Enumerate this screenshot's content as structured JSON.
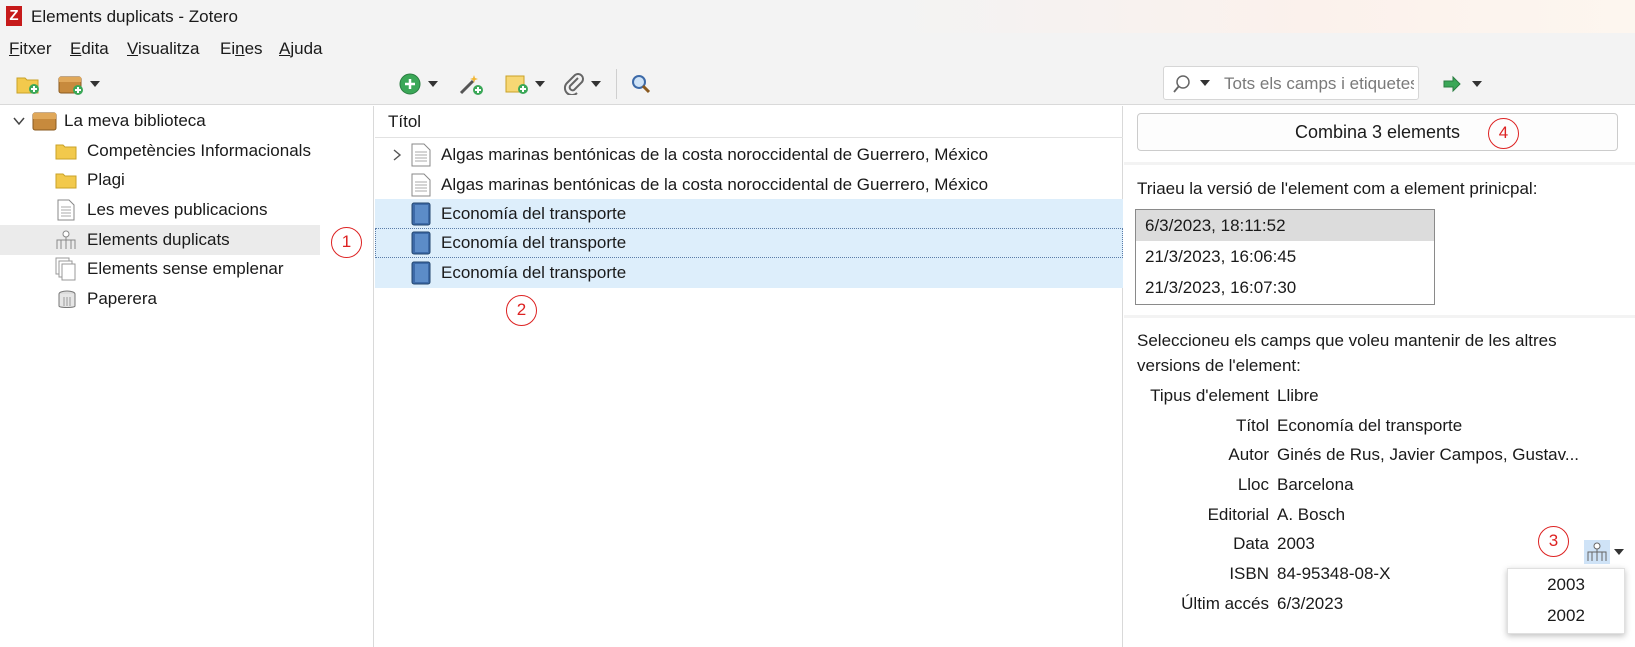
{
  "window": {
    "title": "Elements duplicats - Zotero",
    "app_icon_letter": "Z"
  },
  "menu": [
    {
      "label": "Fitxer",
      "underline": "F",
      "rest": "itxer"
    },
    {
      "label": "Edita",
      "underline": "E",
      "rest": "dita"
    },
    {
      "label": "Visualitza",
      "underline": "V",
      "rest": "isualitza"
    },
    {
      "label": "Eines",
      "pre": "Ei",
      "underline": "n",
      "rest": "es"
    },
    {
      "label": "Ajuda",
      "underline": "A",
      "rest": "juda"
    }
  ],
  "search": {
    "placeholder": "Tots els camps i etiquetes"
  },
  "collections": [
    {
      "label": "La meva biblioteca",
      "icon": "library-icon"
    },
    {
      "label": "Competències Informacionals",
      "icon": "folder-icon"
    },
    {
      "label": "Plagi",
      "icon": "folder-icon"
    },
    {
      "label": "Les meves publicacions",
      "icon": "document-icon"
    },
    {
      "label": "Elements duplicats",
      "icon": "duplicates-icon"
    },
    {
      "label": "Elements sense emplenar",
      "icon": "unfiled-icon"
    },
    {
      "label": "Paperera",
      "icon": "trash-icon"
    }
  ],
  "items_header": {
    "title": "Títol"
  },
  "items": [
    {
      "title": "Algas marinas bentónicas de la costa noroccidental de Guerrero, México",
      "type": "document"
    },
    {
      "title": "Algas marinas bentónicas de la costa noroccidental de Guerrero, México",
      "type": "document"
    },
    {
      "title": "Economía del transporte",
      "type": "book"
    },
    {
      "title": "Economía del transporte",
      "type": "book"
    },
    {
      "title": "Economía del transporte",
      "type": "book"
    }
  ],
  "merge": {
    "button_label": "Combina 3 elements",
    "version_prompt": "Triaeu la versió de l'element com a element prinicpal:",
    "versions": [
      "6/3/2023, 18:11:52",
      "21/3/2023, 16:06:45",
      "21/3/2023, 16:07:30"
    ],
    "fields_prompt_line1": "Seleccioneu els camps que voleu mantenir de les altres",
    "fields_prompt_line2": "versions de l'element:",
    "fields": [
      {
        "label": "Tipus d'element",
        "value": "Llibre"
      },
      {
        "label": "Títol",
        "value": "Economía del transporte"
      },
      {
        "label": "Autor",
        "value": "Ginés de Rus, Javier Campos, Gustav..."
      },
      {
        "label": "Lloc",
        "value": "Barcelona"
      },
      {
        "label": "Editorial",
        "value": "A. Bosch"
      },
      {
        "label": "Data",
        "value": "2003"
      },
      {
        "label": "ISBN",
        "value": "84-95348-08-X"
      },
      {
        "label": "Últim accés",
        "value": "6/3/2023"
      }
    ],
    "date_options": [
      "2003",
      "2002"
    ]
  },
  "callouts": [
    "1",
    "2",
    "3",
    "4"
  ],
  "colors": {
    "callout": "#dd2222",
    "selection": "#ddeefb",
    "book_icon": "#3d6aa8"
  }
}
